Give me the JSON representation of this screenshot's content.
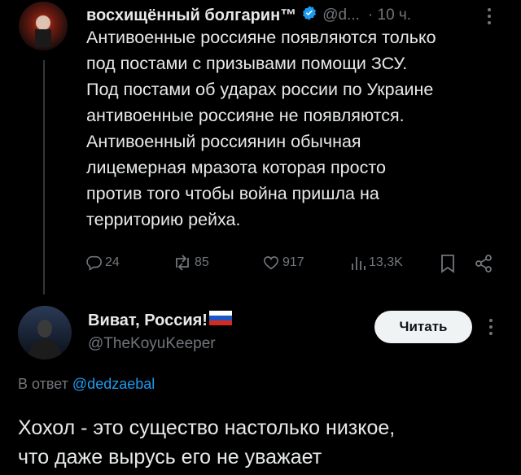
{
  "tweet": {
    "author_name": "восхищённый болгарин™",
    "handle": "@d...",
    "time": "· 10 ч.",
    "lines": [
      "Антивоенные россияне появляются только",
      "под постами с призывами помощи ЗСУ.",
      "Под постами об ударах россии по Украине",
      "антивоенные россияне не появляются.",
      "Антивоенный россиянин обычная",
      "лицемерная мразота которая просто",
      "против того чтобы война пришла на",
      "территорию рейха."
    ],
    "replies": "24",
    "reposts": "85",
    "likes": "917",
    "views": "13,3K"
  },
  "reply": {
    "author_name": "Виват, Россия!",
    "handle": "@TheKoyuKeeper",
    "follow_label": "Читать",
    "reply_prefix": "В ответ",
    "reply_mention": "@dedzaebal",
    "lines": [
      "Хохол - это существо настолько низкое,",
      "что даже вырусь его не уважает"
    ]
  },
  "colors": {
    "background": "#000000",
    "text": "#e7e9ea",
    "muted": "#71767b",
    "accent": "#1d9bf0",
    "verified": "#1d9bf0"
  },
  "icons": [
    "verified-badge-icon",
    "more-icon",
    "reply-icon",
    "repost-icon",
    "like-icon",
    "views-icon",
    "bookmark-icon",
    "share-icon",
    "flag-icon"
  ]
}
